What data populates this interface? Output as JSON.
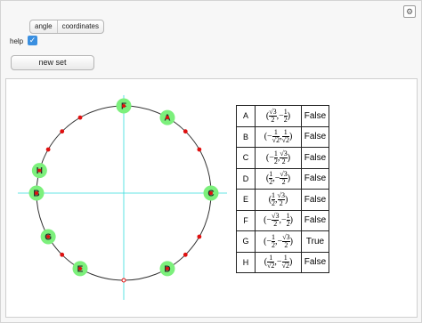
{
  "controls": {
    "mode_options": [
      "angle",
      "coordinates"
    ],
    "help_label": "help",
    "help_checked": true,
    "new_set_label": "new set"
  },
  "circle_points": [
    {
      "letter": "A",
      "coord": "(√3/2, −1/2)",
      "shape": "large",
      "angle_deg": 60
    },
    {
      "letter": "B",
      "coord": "(−1/√2, 1/√2)",
      "shape": "large",
      "angle_deg": 180
    },
    {
      "letter": "C",
      "coord": "(−1/2, √3/2)",
      "shape": "large",
      "angle_deg": 0
    },
    {
      "letter": "D",
      "coord": "(1/2, −√3/2)",
      "shape": "large",
      "angle_deg": 300
    },
    {
      "letter": "E",
      "coord": "(1/2, √3/2)",
      "shape": "large",
      "angle_deg": 240
    },
    {
      "letter": "F",
      "coord": "(−√3/2, −1/2)",
      "shape": "large",
      "angle_deg": 90
    },
    {
      "letter": "G",
      "coord": "(−1/2, −√3/2)",
      "shape": "large",
      "angle_deg": 210
    },
    {
      "letter": "H",
      "coord": "(1/√2, −1/√2)",
      "shape": "large",
      "angle_deg": 165
    }
  ],
  "table": {
    "rows": [
      {
        "letter": "A",
        "num1": "√3",
        "den1": "2",
        "sign1": "",
        "num2": "1",
        "den2": "2",
        "sign2": "−",
        "result": "False"
      },
      {
        "letter": "B",
        "num1": "1",
        "den1": "√2",
        "sign1": "−",
        "num2": "1",
        "den2": "√2",
        "sign2": "",
        "result": "False"
      },
      {
        "letter": "C",
        "num1": "1",
        "den1": "2",
        "sign1": "−",
        "num2": "√3",
        "den2": "2",
        "sign2": "",
        "result": "False"
      },
      {
        "letter": "D",
        "num1": "1",
        "den1": "2",
        "sign1": "",
        "num2": "√3",
        "den2": "2",
        "sign2": "−",
        "result": "False"
      },
      {
        "letter": "E",
        "num1": "1",
        "den1": "2",
        "sign1": "",
        "num2": "√3",
        "den2": "2",
        "sign2": "",
        "result": "False"
      },
      {
        "letter": "F",
        "num1": "√3",
        "den1": "2",
        "sign1": "−",
        "num2": "1",
        "den2": "2",
        "sign2": "−",
        "result": "False"
      },
      {
        "letter": "G",
        "num1": "1",
        "den1": "2",
        "sign1": "−",
        "num2": "√3",
        "den2": "2",
        "sign2": "−",
        "result": "True"
      },
      {
        "letter": "H",
        "num1": "1",
        "den1": "√2",
        "sign1": "",
        "num2": "1",
        "den2": "√2",
        "sign2": "−",
        "result": "False"
      }
    ]
  },
  "colors": {
    "marker_green": "#7cf07c",
    "dot_red": "#e01010",
    "axis_cyan": "#33dddd",
    "circle_line": "#333333",
    "checkbox_blue": "#3a8fe0"
  },
  "icons": {
    "settings": "gear-icon",
    "check": "checkmark-icon"
  }
}
